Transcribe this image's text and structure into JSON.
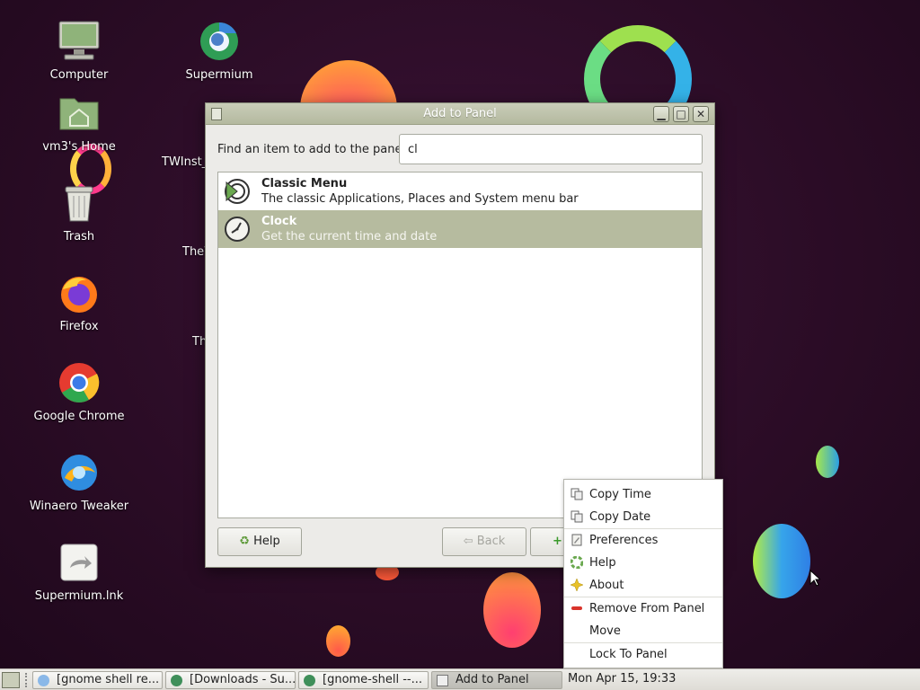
{
  "desktop": {
    "icons": [
      {
        "label": "Computer"
      },
      {
        "label": "vm3's Home"
      },
      {
        "label": "Trash"
      },
      {
        "label": "Firefox"
      },
      {
        "label": "Google Chrome"
      },
      {
        "label": "Winaero Tweaker"
      },
      {
        "label": "Supermium.lnk"
      },
      {
        "label": "Supermium"
      }
    ],
    "clipped_labels": [
      "TWInst_",
      "TheW",
      "Th"
    ]
  },
  "dialog": {
    "title": "Add to Panel",
    "find_label": "Find an item to add to the panel:",
    "search_value": "cl",
    "items": [
      {
        "title": "Classic Menu",
        "description": "The classic Applications, Places and System menu bar",
        "selected": false
      },
      {
        "title": "Clock",
        "description": "Get the current time and date",
        "selected": true
      }
    ],
    "buttons": {
      "help": "Help",
      "back": "Back"
    }
  },
  "context_menu": {
    "items": [
      {
        "label": "Copy Time",
        "icon": "copy-icon"
      },
      {
        "label": "Copy Date",
        "icon": "copy-icon"
      },
      {
        "label": "Preferences",
        "icon": "preferences-icon"
      },
      {
        "label": "Help",
        "icon": "help-icon"
      },
      {
        "label": "About",
        "icon": "about-icon"
      },
      {
        "label": "Remove From Panel",
        "icon": "remove-icon"
      },
      {
        "label": "Move",
        "icon": ""
      },
      {
        "label": "Lock To Panel",
        "icon": ""
      }
    ]
  },
  "taskbar": {
    "items": [
      {
        "label": "[gnome shell re..."
      },
      {
        "label": "[Downloads - Su..."
      },
      {
        "label": "[gnome-shell --..."
      },
      {
        "label": "Add to Panel"
      }
    ],
    "clock": "Mon Apr 15, 19:33"
  },
  "colors": {
    "selection": "#b6bb9f",
    "titlebar": "#c1c6ae",
    "desktop_bg": "#2a0c25"
  }
}
